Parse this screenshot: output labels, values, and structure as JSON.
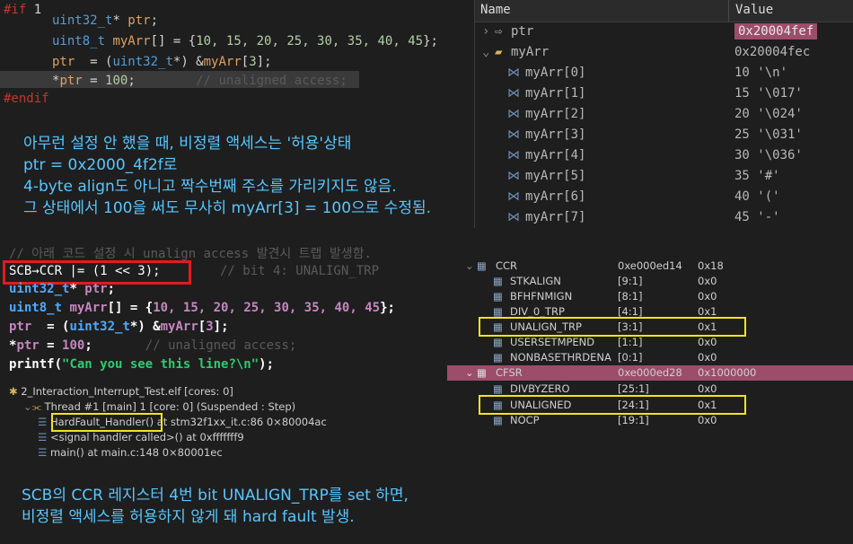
{
  "top_code": {
    "l1_if": "#if",
    "l1_num": " 1",
    "l2_type": "uint32_t",
    "l2_rest": "* ",
    "l2_id": "ptr",
    "l2_end": ";",
    "l3_type": "uint8_t",
    "l3_id": "myArr",
    "l3_rest": "[] = {",
    "l3_nums": "10, 15, 20, 25, 30, 35, 40, 45",
    "l3_end": "};",
    "l4_id": "ptr",
    "l4_a": "  = (",
    "l4_type": "uint32_t",
    "l4_b": "*) &",
    "l4_arr": "myArr",
    "l4_c": "[",
    "l4_idx": "3",
    "l4_d": "];",
    "l5_star": "*",
    "l5_id": "ptr",
    "l5_a": " = ",
    "l5_num": "100",
    "l5_b": ";",
    "l5_cm": "// unaligned access;",
    "l6_endif": "#endif"
  },
  "note1": {
    "line1": "아무런 설정 안 했을 때, 비정렬 액세스는 '허용'상태",
    "line2": "ptr = 0x2000_4f2f로",
    "line3": "4-byte align도 아니고 짝수번째 주소를 가리키지도 않음.",
    "line4": "그 상태에서 100을 써도 무사히 myArr[3] = 100으로 수정됨."
  },
  "variables": {
    "col_name": "Name",
    "col_value": "Value",
    "rows": [
      {
        "name": "ptr",
        "value": "0x20004fef"
      },
      {
        "name": "myArr",
        "value": "0x20004fec"
      },
      {
        "name": "myArr[0]",
        "value": "10 '\\n'"
      },
      {
        "name": "myArr[1]",
        "value": "15 '\\017'"
      },
      {
        "name": "myArr[2]",
        "value": "20 '\\024'"
      },
      {
        "name": "myArr[3]",
        "value": "25 '\\031'"
      },
      {
        "name": "myArr[4]",
        "value": "30 '\\036'"
      },
      {
        "name": "myArr[5]",
        "value": "35 '#'"
      },
      {
        "name": "myArr[6]",
        "value": "40 '('"
      },
      {
        "name": "myArr[7]",
        "value": "45 '-'"
      }
    ]
  },
  "bottom_code": {
    "comment": "// 아래 코드 설정 시 unalign access 발견시 트랩 발생함.",
    "scb_line": "SCB→CCR |= (1 << 3);",
    "scb_comment": "// bit 4: UNALIGN_TRP",
    "l2_type": "uint32_t",
    "l2_rest": "* ",
    "l2_id": "ptr",
    "l2_end": ";",
    "l3_type": "uint8_t",
    "l3_id": "myArr",
    "l3_rest": "[] = {",
    "l3_nums": "10, 15, 20, 25, 30, 35, 40, 45",
    "l3_end": "};",
    "l4_id": "ptr",
    "l4_a": "  = (",
    "l4_type": "uint32_t",
    "l4_b": "*) &",
    "l4_arr": "myArr",
    "l4_c": "[",
    "l4_idx": "3",
    "l4_d": "];",
    "l5_star": "*",
    "l5_id": "ptr",
    "l5_a": " = ",
    "l5_num": "100",
    "l5_b": ";",
    "l5_cm": "// unaligned access;",
    "l6_fn": "printf",
    "l6_a": "(",
    "l6_str": "\"Can you see this line?\\n\"",
    "l6_b": ");"
  },
  "registers": {
    "rows": [
      {
        "name": "CCR",
        "addr": "0xe000ed14",
        "value": "0x18"
      },
      {
        "name": "STKALIGN",
        "addr": "[9:1]",
        "value": "0x0"
      },
      {
        "name": "BFHFNMIGN",
        "addr": "[8:1]",
        "value": "0x0"
      },
      {
        "name": "DIV_0_TRP",
        "addr": "[4:1]",
        "value": "0x1"
      },
      {
        "name": "UNALIGN_TRP",
        "addr": "[3:1]",
        "value": "0x1"
      },
      {
        "name": "USERSETMPEND",
        "addr": "[1:1]",
        "value": "0x0"
      },
      {
        "name": "NONBASETHRDENA",
        "addr": "[0:1]",
        "value": "0x0"
      },
      {
        "name": "CFSR",
        "addr": "0xe000ed28",
        "value": "0x1000000"
      },
      {
        "name": "DIVBYZERO",
        "addr": "[25:1]",
        "value": "0x0"
      },
      {
        "name": "UNALIGNED",
        "addr": "[24:1]",
        "value": "0x1"
      },
      {
        "name": "NOCP",
        "addr": "[19:1]",
        "value": "0x0"
      }
    ]
  },
  "debug": {
    "process": "2_Interaction_Interrupt_Test.elf [cores: 0]",
    "thread": "Thread #1 [main] 1 [core: 0] (Suspended : Step)",
    "frame1_fn": "HardFault_Handler()",
    "frame1_rest": "at stm32f1xx_it.c:86 0×80004ac",
    "frame2": "<signal handler called>() at 0xfffffff9",
    "frame3": "main() at main.c:148 0×80001ec"
  },
  "note2": {
    "line1": "SCB의 CCR 레지스터 4번 bit UNALIGN_TRP를 set 하면,",
    "line2": "비정렬 액세스를 허용하지 않게 돼 hard fault 발생."
  },
  "colors": {
    "background": "#1e1e1e",
    "note_text": "#59c6ff",
    "highlight_value": "#9b4d6a",
    "red_box": "#e21c1c",
    "yellow_box": "#f2e51c"
  }
}
